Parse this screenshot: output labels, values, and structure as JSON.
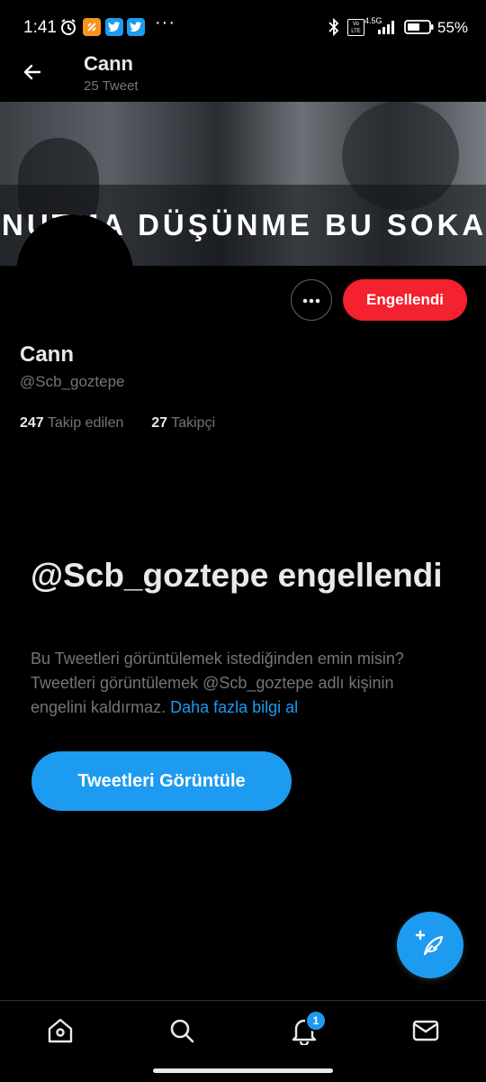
{
  "status_bar": {
    "time": "1:41",
    "network": "4.5G",
    "volte": "Vo LTE",
    "battery": "55%",
    "more": "···"
  },
  "header": {
    "title": "Cann",
    "subtitle": "25 Tweet"
  },
  "banner": {
    "text": "NUTMA DÜŞÜNME BU SOKAK AĞZ"
  },
  "actions": {
    "blocked_label": "Engellendi"
  },
  "profile": {
    "name": "Cann",
    "handle": "@Scb_goztepe",
    "following_count": "247",
    "following_label": "Takip edilen",
    "followers_count": "27",
    "followers_label": "Takipçi"
  },
  "blocked_notice": {
    "title": "@Scb_goztepe engellendi",
    "description": "Bu Tweetleri görüntülemek istediğinden emin misin? Tweetleri görüntülemek @Scb_goztepe adlı kişinin engelini kaldırmaz.",
    "link_text": "Daha fazla bilgi al",
    "button_label": "Tweetleri Görüntüle"
  },
  "bottom_nav": {
    "notifications_badge": "1"
  },
  "colors": {
    "accent": "#1d9bf0",
    "blocked": "#f4212e",
    "background": "#000000",
    "muted_text": "#71767b"
  },
  "icons": [
    "back-arrow-icon",
    "alarm-icon",
    "twitter-icon",
    "bluetooth-icon",
    "signal-icon",
    "battery-icon",
    "more-icon",
    "compose-icon",
    "home-icon",
    "search-icon",
    "bell-icon",
    "mail-icon"
  ]
}
